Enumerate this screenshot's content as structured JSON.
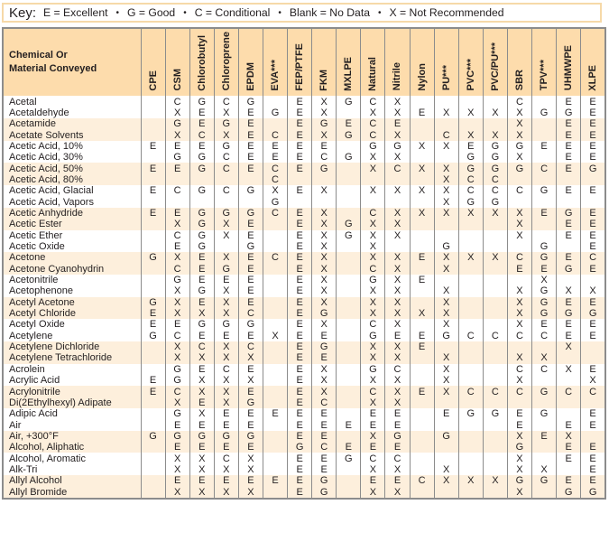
{
  "key": {
    "title": "Key:",
    "items": [
      "E = Excellent",
      "G = Good",
      "C = Conditional",
      "Blank = No Data",
      "X = Not Recommended"
    ],
    "separator": "•"
  },
  "colors": {
    "header_bg": "#fddcac",
    "shade_row_bg": "#fdefdc",
    "border": "#8c8c8c",
    "key_border": "#f6d9a8"
  },
  "table": {
    "name_header_line1": "Chemical Or",
    "name_header_line2": "Material Conveyed",
    "columns": [
      "CPE",
      "CSM",
      "Chlorobutyl",
      "Chloroprene",
      "EPDM",
      "EVA***",
      "FEP/PTFE",
      "FKM",
      "MXLPE",
      "Natural",
      "Nitrile",
      "Nylon",
      "PU***",
      "PVC***",
      "PVC/PU***",
      "SBR",
      "TPV***",
      "UHMWPE",
      "XLPE"
    ],
    "rows": [
      {
        "name": "Acetal",
        "values": [
          "",
          "C",
          "G",
          "C",
          "G",
          "",
          "E",
          "X",
          "G",
          "C",
          "X",
          "",
          "",
          "",
          "",
          "C",
          "",
          "E",
          "E"
        ]
      },
      {
        "name": "Acetaldehyde",
        "values": [
          "",
          "X",
          "E",
          "X",
          "E",
          "G",
          "E",
          "X",
          "",
          "X",
          "X",
          "E",
          "X",
          "X",
          "X",
          "X",
          "G",
          "G",
          "E"
        ]
      },
      {
        "name": "Acetamide",
        "values": [
          "",
          "G",
          "E",
          "G",
          "E",
          "",
          "E",
          "G",
          "E",
          "C",
          "E",
          "",
          "",
          "",
          "",
          "X",
          "",
          "E",
          "E"
        ]
      },
      {
        "name": "Acetate Solvents",
        "values": [
          "",
          "X",
          "C",
          "X",
          "E",
          "C",
          "E",
          "X",
          "G",
          "C",
          "X",
          "",
          "C",
          "X",
          "X",
          "X",
          "",
          "E",
          "E"
        ]
      },
      {
        "name": "Acetic Acid, 10%",
        "values": [
          "E",
          "E",
          "E",
          "G",
          "E",
          "E",
          "E",
          "E",
          "",
          "G",
          "G",
          "X",
          "X",
          "E",
          "G",
          "G",
          "E",
          "E",
          "E"
        ]
      },
      {
        "name": "Acetic Acid, 30%",
        "values": [
          "",
          "G",
          "G",
          "C",
          "E",
          "E",
          "E",
          "C",
          "G",
          "X",
          "X",
          "",
          "",
          "G",
          "G",
          "X",
          "",
          "E",
          "E"
        ]
      },
      {
        "name": "Acetic Acid, 50%",
        "values": [
          "E",
          "E",
          "G",
          "C",
          "E",
          "C",
          "E",
          "G",
          "",
          "X",
          "C",
          "X",
          "X",
          "G",
          "G",
          "G",
          "C",
          "E",
          "G"
        ]
      },
      {
        "name": "Acetic Acid, 80%",
        "values": [
          "",
          "",
          "",
          "",
          "",
          "C",
          "",
          "",
          "",
          "",
          "",
          "",
          "X",
          "C",
          "C",
          "",
          "",
          "",
          ""
        ]
      },
      {
        "name": "Acetic Acid, Glacial",
        "values": [
          "E",
          "C",
          "G",
          "C",
          "G",
          "X",
          "E",
          "X",
          "",
          "X",
          "X",
          "X",
          "X",
          "C",
          "C",
          "C",
          "G",
          "E",
          "E"
        ]
      },
      {
        "name": "Acetic Acid, Vapors",
        "values": [
          "",
          "",
          "",
          "",
          "",
          "G",
          "",
          "",
          "",
          "",
          "",
          "",
          "X",
          "G",
          "G",
          "",
          "",
          "",
          ""
        ]
      },
      {
        "name": "Acetic Anhydride",
        "values": [
          "E",
          "E",
          "G",
          "G",
          "G",
          "C",
          "E",
          "X",
          "",
          "C",
          "X",
          "X",
          "X",
          "X",
          "X",
          "X",
          "E",
          "G",
          "E"
        ]
      },
      {
        "name": "Acetic Ester",
        "values": [
          "",
          "X",
          "G",
          "X",
          "E",
          "",
          "E",
          "X",
          "G",
          "X",
          "X",
          "",
          "",
          "",
          "",
          "X",
          "",
          "E",
          "E"
        ]
      },
      {
        "name": "Acetic Ether",
        "values": [
          "",
          "C",
          "G",
          "X",
          "E",
          "",
          "E",
          "X",
          "G",
          "X",
          "X",
          "",
          "",
          "",
          "",
          "X",
          "",
          "E",
          "E"
        ]
      },
      {
        "name": "Acetic Oxide",
        "values": [
          "",
          "E",
          "G",
          "",
          "G",
          "",
          "E",
          "X",
          "",
          "X",
          "",
          "",
          "G",
          "",
          "",
          "",
          "G",
          "",
          "E"
        ]
      },
      {
        "name": "Acetone",
        "values": [
          "G",
          "X",
          "E",
          "X",
          "E",
          "C",
          "E",
          "X",
          "",
          "X",
          "X",
          "E",
          "X",
          "X",
          "X",
          "C",
          "G",
          "E",
          "C"
        ]
      },
      {
        "name": "Acetone Cyanohydrin",
        "values": [
          "",
          "C",
          "E",
          "G",
          "E",
          "",
          "E",
          "X",
          "",
          "C",
          "X",
          "",
          "X",
          "",
          "",
          "E",
          "E",
          "G",
          "E"
        ]
      },
      {
        "name": "Acetonitrile",
        "values": [
          "",
          "G",
          "E",
          "E",
          "E",
          "",
          "E",
          "X",
          "",
          "G",
          "X",
          "E",
          "",
          "",
          "",
          "",
          "X",
          "",
          ""
        ]
      },
      {
        "name": "Acetophenone",
        "values": [
          "",
          "X",
          "G",
          "X",
          "E",
          "",
          "E",
          "X",
          "",
          "X",
          "X",
          "",
          "X",
          "",
          "",
          "X",
          "G",
          "X",
          "X"
        ]
      },
      {
        "name": "Acetyl Acetone",
        "values": [
          "G",
          "X",
          "E",
          "X",
          "E",
          "",
          "E",
          "X",
          "",
          "X",
          "X",
          "",
          "X",
          "",
          "",
          "X",
          "G",
          "E",
          "E"
        ]
      },
      {
        "name": "Acetyl Chloride",
        "values": [
          "E",
          "X",
          "X",
          "X",
          "C",
          "",
          "E",
          "G",
          "",
          "X",
          "X",
          "X",
          "X",
          "",
          "",
          "X",
          "G",
          "G",
          "G"
        ]
      },
      {
        "name": "Acetyl Oxide",
        "values": [
          "E",
          "E",
          "G",
          "G",
          "G",
          "",
          "E",
          "X",
          "",
          "C",
          "X",
          "",
          "X",
          "",
          "",
          "X",
          "E",
          "E",
          "E"
        ]
      },
      {
        "name": "Acetylene",
        "values": [
          "G",
          "C",
          "E",
          "E",
          "E",
          "X",
          "E",
          "E",
          "",
          "G",
          "E",
          "E",
          "G",
          "C",
          "C",
          "C",
          "C",
          "E",
          "E"
        ]
      },
      {
        "name": "Acetylene Dichloride",
        "values": [
          "",
          "X",
          "C",
          "X",
          "C",
          "",
          "E",
          "G",
          "",
          "X",
          "X",
          "E",
          "",
          "",
          "",
          "",
          "",
          "X",
          ""
        ]
      },
      {
        "name": "Acetylene Tetrachloride",
        "values": [
          "",
          "X",
          "X",
          "X",
          "X",
          "",
          "E",
          "E",
          "",
          "X",
          "X",
          "",
          "X",
          "",
          "",
          "X",
          "X",
          "",
          ""
        ]
      },
      {
        "name": "Acrolein",
        "values": [
          "",
          "G",
          "E",
          "C",
          "E",
          "",
          "E",
          "X",
          "",
          "G",
          "C",
          "",
          "X",
          "",
          "",
          "C",
          "C",
          "X",
          "E"
        ]
      },
      {
        "name": "Acrylic Acid",
        "values": [
          "E",
          "G",
          "X",
          "X",
          "X",
          "",
          "E",
          "X",
          "",
          "X",
          "X",
          "",
          "X",
          "",
          "",
          "X",
          "",
          "",
          "X"
        ]
      },
      {
        "name": "Acrylonitrile",
        "values": [
          "E",
          "C",
          "X",
          "X",
          "E",
          "",
          "E",
          "X",
          "",
          "C",
          "X",
          "E",
          "X",
          "C",
          "C",
          "C",
          "G",
          "C",
          "C"
        ]
      },
      {
        "name": "Di(2Ethylhexyl) Adipate",
        "values": [
          "",
          "X",
          "E",
          "X",
          "G",
          "",
          "E",
          "C",
          "",
          "X",
          "X",
          "",
          "",
          "",
          "",
          "",
          "",
          "",
          ""
        ]
      },
      {
        "name": "Adipic Acid",
        "values": [
          "",
          "G",
          "X",
          "E",
          "E",
          "E",
          "E",
          "E",
          "",
          "E",
          "E",
          "",
          "E",
          "G",
          "G",
          "E",
          "G",
          "",
          "E"
        ]
      },
      {
        "name": "Air",
        "values": [
          "",
          "E",
          "E",
          "E",
          "E",
          "",
          "E",
          "E",
          "E",
          "E",
          "E",
          "",
          "",
          "",
          "",
          "E",
          "",
          "E",
          "E"
        ]
      },
      {
        "name": "Air, +300°F",
        "values": [
          "G",
          "G",
          "G",
          "G",
          "G",
          "",
          "E",
          "E",
          "",
          "X",
          "G",
          "",
          "G",
          "",
          "",
          "X",
          "E",
          "X",
          ""
        ]
      },
      {
        "name": "Alcohol, Aliphatic",
        "values": [
          "",
          "E",
          "E",
          "E",
          "E",
          "",
          "G",
          "C",
          "E",
          "E",
          "E",
          "",
          "",
          "",
          "",
          "G",
          "",
          "E",
          "E"
        ]
      },
      {
        "name": "Alcohol, Aromatic",
        "values": [
          "",
          "X",
          "X",
          "C",
          "X",
          "",
          "E",
          "E",
          "G",
          "C",
          "C",
          "",
          "",
          "",
          "",
          "X",
          "",
          "E",
          "E"
        ]
      },
      {
        "name": "Alk-Tri",
        "values": [
          "",
          "X",
          "X",
          "X",
          "X",
          "",
          "E",
          "E",
          "",
          "X",
          "X",
          "",
          "X",
          "",
          "",
          "X",
          "X",
          "",
          "E"
        ]
      },
      {
        "name": "Allyl Alcohol",
        "values": [
          "",
          "E",
          "E",
          "E",
          "E",
          "E",
          "E",
          "G",
          "",
          "E",
          "E",
          "C",
          "X",
          "X",
          "X",
          "G",
          "G",
          "E",
          "E"
        ]
      },
      {
        "name": "Allyl Bromide",
        "values": [
          "",
          "X",
          "X",
          "X",
          "X",
          "",
          "E",
          "G",
          "",
          "X",
          "X",
          "",
          "",
          "",
          "",
          "X",
          "",
          "G",
          "G"
        ]
      }
    ]
  }
}
